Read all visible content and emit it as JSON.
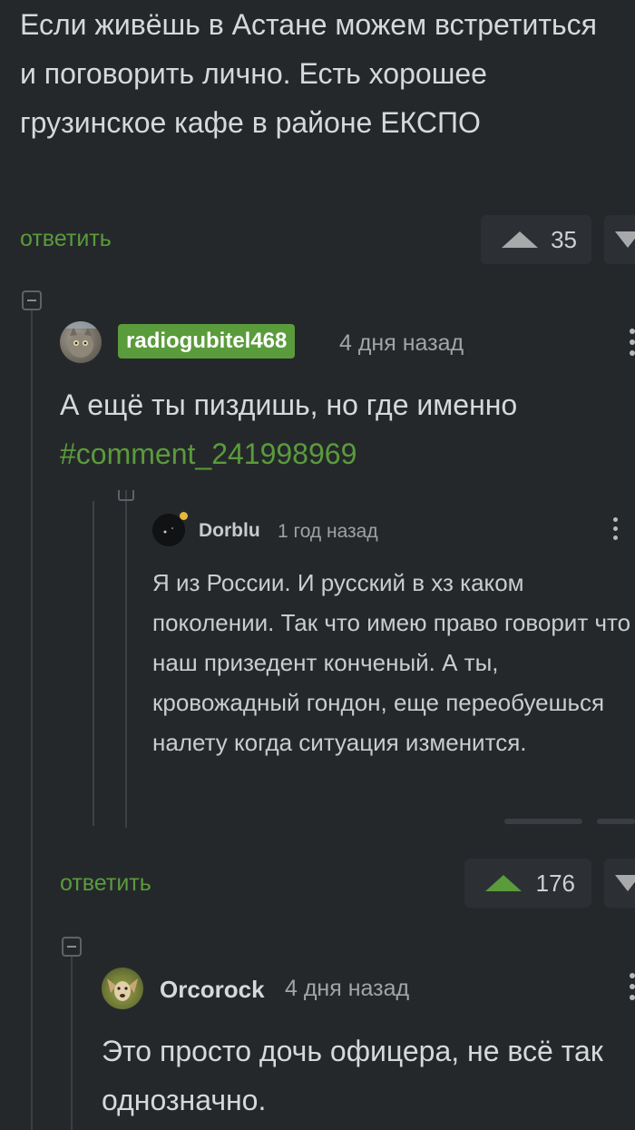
{
  "top_comment": {
    "text": "Если живёшь в Астане можем встретиться и поговорить лично. Есть хорошее грузинское кафе в районе ЕКСПО",
    "reply_label": "ответить",
    "rating": "35"
  },
  "comment_radiogubitel": {
    "author": "radiogubitel468",
    "time": "4 дня назад",
    "text": "А ещё ты пиздишь, но где именно",
    "hashtag": "#comment_241998969",
    "reply_label": "ответить",
    "rating": "176"
  },
  "quoted_comment": {
    "author": "Dorblu",
    "time": "1 год назад",
    "text": "Я из России. И русский в хз каком поколении. Так что имею право говорит что наш призедент конченый. А ты, кровожадный гондон, еще переобуешься налету когда ситуация изменится."
  },
  "comment_orcorock": {
    "author": "Orcorock",
    "time": "4 дня назад",
    "text": "Это просто дочь офицера, не всё так однозначно."
  },
  "colors": {
    "background": "#25282b",
    "accent_green": "#5a9b3c",
    "text": "#d7d8d9",
    "muted": "#a2a4a6"
  },
  "icons": {
    "upvote": "triangle-up-icon",
    "downvote": "triangle-down-icon",
    "collapse": "minus-square-icon",
    "menu": "vertical-dots-icon"
  }
}
